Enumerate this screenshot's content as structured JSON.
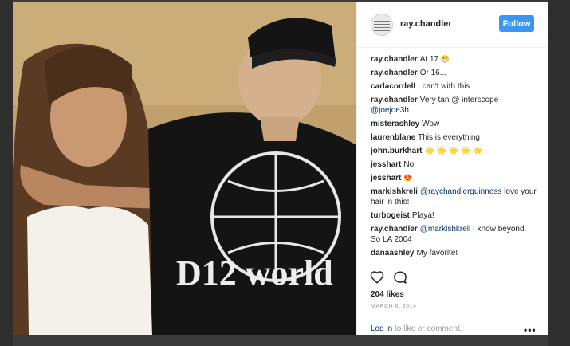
{
  "post": {
    "username": "ray.chandler",
    "follow_label": "Follow",
    "shirt_text": "D12 world"
  },
  "comments": [
    {
      "user": "ray.chandler",
      "text": "At 17",
      "emoji": "😁"
    },
    {
      "user": "ray.chandler",
      "text": "Or 16..."
    },
    {
      "user": "carlacordell",
      "text": "I can't with this"
    },
    {
      "user": "ray.chandler",
      "text": "Very tan @ interscope",
      "mention": "@joejoe3h"
    },
    {
      "user": "misterashley",
      "text": "Wow"
    },
    {
      "user": "laurenblane",
      "text": "This is everything"
    },
    {
      "user": "john.burkhart",
      "stars": "🌟 🌟 🌟 🌟 🌟"
    },
    {
      "user": "jesshart",
      "text": "No!"
    },
    {
      "user": "jesshart",
      "emoji": "😍"
    },
    {
      "user": "markishkreli",
      "mention": "@raychandlerguinness",
      "text": "love your hair in this!"
    },
    {
      "user": "turbogeist",
      "text": "Playa!"
    },
    {
      "user": "ray.chandler",
      "mention": "@markishkreli",
      "text": "I know beyond. So LA 2004"
    },
    {
      "user": "danaashley",
      "text": "My favorite!"
    }
  ],
  "footer": {
    "likes": "204 likes",
    "date": "MARCH 6, 2014",
    "login_link": "Log in",
    "login_rest": " to like or comment.",
    "more": "•••"
  },
  "icons": {
    "heart": "heart-icon",
    "comment": "comment-icon",
    "more": "more-options-icon"
  },
  "colors": {
    "follow_button": "#3897f0",
    "mention": "#003569"
  }
}
